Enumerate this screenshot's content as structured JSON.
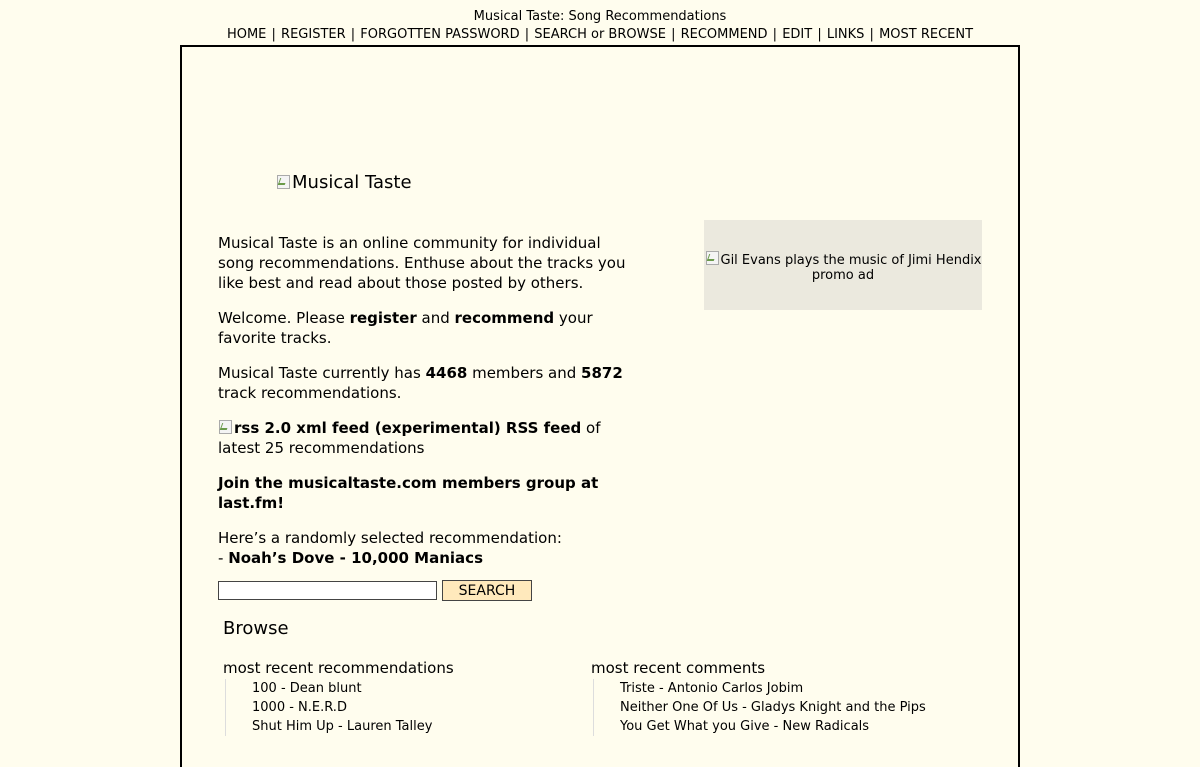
{
  "header": {
    "site_title": "Musical Taste: Song Recommendations"
  },
  "nav": {
    "items": [
      {
        "label": "HOME"
      },
      {
        "label": "REGISTER"
      },
      {
        "label": "FORGOTTEN PASSWORD"
      },
      {
        "label": " SEARCH or BROWSE"
      },
      {
        "label": "RECOMMEND"
      },
      {
        "label": "EDIT"
      },
      {
        "label": "LINKS"
      },
      {
        "label": "MOST RECENT"
      }
    ],
    "separator": " | "
  },
  "logo": {
    "alt_text": "Musical Taste"
  },
  "intro": {
    "description": "Musical Taste is an online community for individual song recommendations. Enthuse about the tracks you like best and read about those posted by others.",
    "welcome_prefix": "Welcome. Please ",
    "register_link": "register",
    "welcome_and": " and ",
    "recommend_link": "recommend",
    "welcome_suffix": " your favorite tracks.",
    "stats_prefix": "Musical Taste currently has ",
    "members_count": "4468",
    "stats_mid": " members and ",
    "recommendations_count": "5872",
    "stats_suffix": " track recommendations.",
    "rss_img_alt": "rss 2.0 xml feed (experimental)",
    "rss_link": " RSS feed",
    "rss_suffix": " of latest 25 recommendations",
    "join_group": "Join the musicaltaste.com members group at last.fm!",
    "random_prefix": "Here’s a randomly selected recommendation:",
    "random_dash": "- ",
    "random_song": "Noah’s Dove",
    "random_sep": " - ",
    "random_artist": "10,000 Maniacs"
  },
  "search": {
    "value": "",
    "button_label": "SEARCH"
  },
  "browse": {
    "heading": "Browse",
    "recent_recommendations": {
      "title": "most recent recommendations",
      "items": [
        {
          "label": "100 - Dean blunt"
        },
        {
          "label": "1000 - N.E.R.D"
        },
        {
          "label": "Shut Him Up - Lauren Talley"
        }
      ]
    },
    "recent_comments": {
      "title": "most recent comments",
      "items": [
        {
          "label": "Triste - Antonio Carlos Jobim"
        },
        {
          "label": "Neither One Of Us - Gladys Knight and the Pips"
        },
        {
          "label": "You Get What you Give - New Radicals"
        }
      ]
    }
  },
  "ad": {
    "alt_text": "Gil Evans plays the music of Jimi Hendix promo ad"
  },
  "colors": {
    "background": "#fffdee",
    "button": "#ffe9bc",
    "ad_background": "#ebe9de"
  }
}
